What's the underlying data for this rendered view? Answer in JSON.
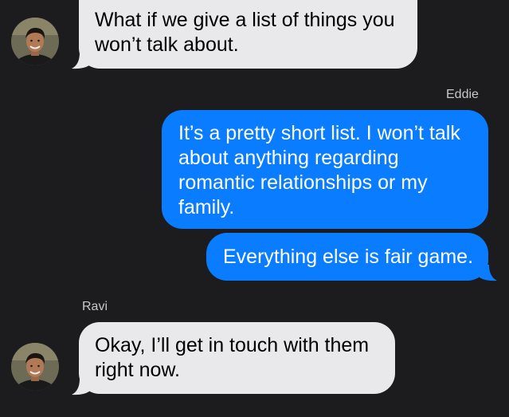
{
  "colors": {
    "background": "#1c1c1e",
    "incoming_bubble": "#e9e9eb",
    "outgoing_bubble": "#0a7cff",
    "sender_name": "#c7c7cc"
  },
  "messages": [
    {
      "direction": "incoming",
      "text": "What if we give a list of things you\nwon’t talk about."
    },
    {
      "direction": "outgoing",
      "sender": "Eddie",
      "text": "It’s a pretty short list. I won’t talk\nabout anything regarding\nromantic relationships or my\nfamily."
    },
    {
      "direction": "outgoing",
      "text": "Everything else is fair game."
    },
    {
      "direction": "incoming",
      "sender": "Ravi",
      "text": "Okay, I’ll get in touch with them\nright now."
    }
  ],
  "icons": [
    "avatar-photo-icon"
  ]
}
